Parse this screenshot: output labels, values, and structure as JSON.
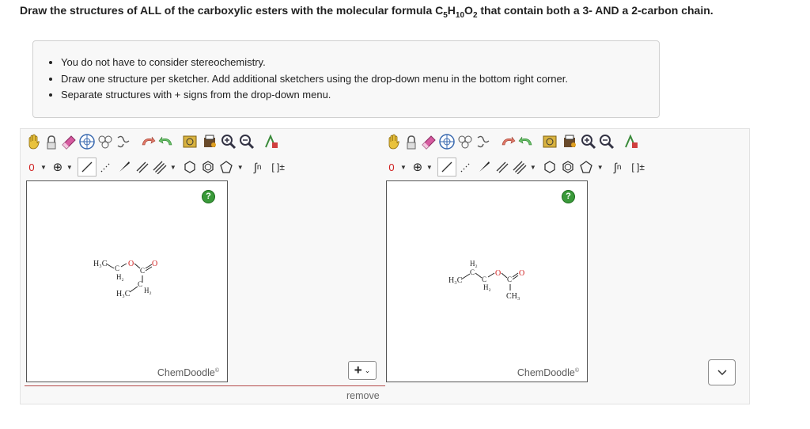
{
  "question": {
    "prefix": "Draw the structures of ALL of the carboxylic esters with the molecular formula C",
    "c_count": "5",
    "h_label": "H",
    "h_count": "10",
    "o_label": "O",
    "o_count": "2",
    "suffix": " that contain both a 3- AND a 2-carbon chain."
  },
  "hints": [
    "You do not have to consider stereochemistry.",
    "Draw one structure per sketcher. Add additional sketchers using the drop-down menu in the bottom right corner.",
    "Separate structures with + signs from the drop-down menu."
  ],
  "sketchers": [
    {
      "brand": "ChemDoodle",
      "brand_mark": "©",
      "help": "?",
      "molecule_labels": {
        "h3c_top": "H₃C",
        "c1": "C",
        "h2_1": "H₂",
        "o_ester": "O",
        "c_carbonyl": "C",
        "o_carbonyl": "O",
        "h3c_bottom": "H₃C",
        "c2": "C",
        "h2_2": "H₂"
      }
    },
    {
      "brand": "ChemDoodle",
      "brand_mark": "©",
      "help": "?",
      "molecule_labels": {
        "h3c": "H₃C",
        "h2_top": "H₂",
        "c1": "C",
        "c2": "C",
        "h2_bottom": "H₂",
        "o_ester": "O",
        "c_carbonyl": "C",
        "o_carbonyl": "O",
        "ch3": "CH₃"
      }
    }
  ],
  "toolbar": {
    "charge_label": "0",
    "plus_label": "⊕",
    "polymer_label": "n",
    "bracket_label": "[ ]±"
  },
  "add_button": {
    "label": "+",
    "chevron": "⌄"
  },
  "remove_label": "remove",
  "colors": {
    "help_green": "#3a9a3a",
    "divider_red": "#b54a4a",
    "charge_red": "#d02020"
  }
}
